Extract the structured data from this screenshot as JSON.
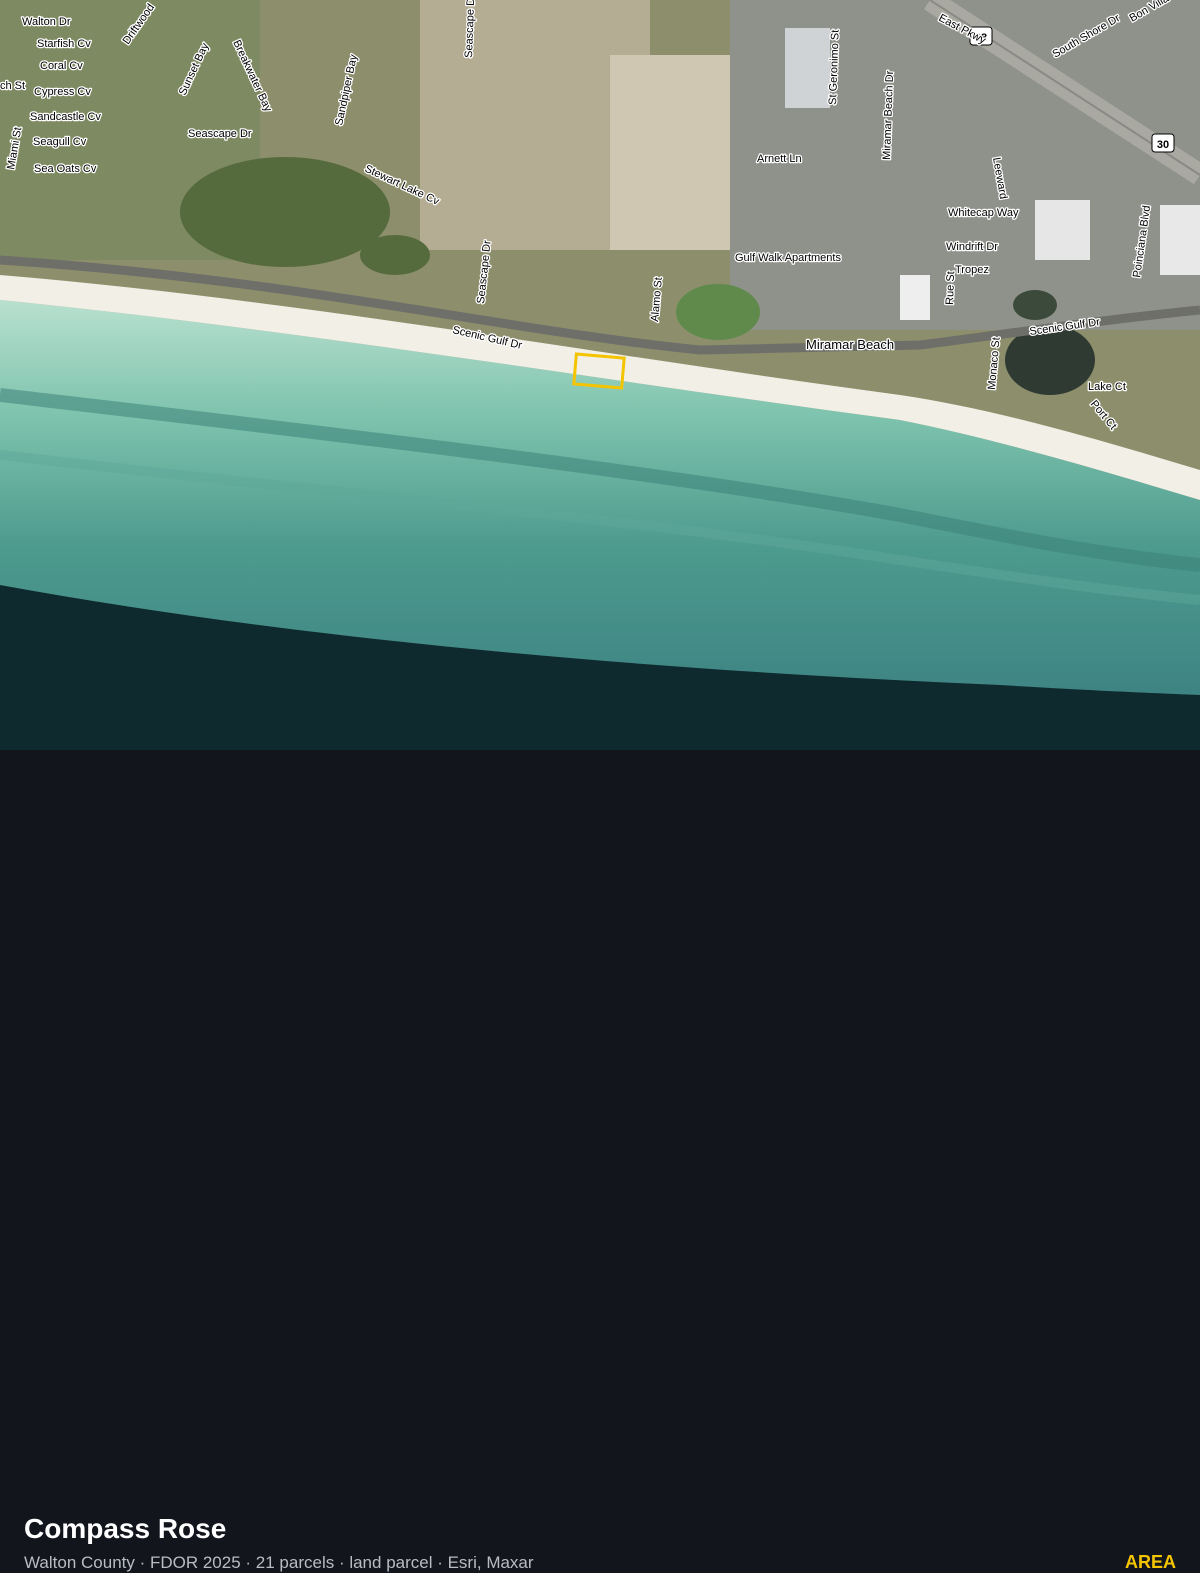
{
  "map": {
    "labels": {
      "walton_dr": "Walton Dr",
      "starfish_cv": "Starfish Cv",
      "coral_cv": "Coral Cv",
      "cypress_cv": "Cypress Cv",
      "sandcastle_cv": "Sandcastle Cv",
      "seagull_cv": "Seagull Cv",
      "sea_oats_cv": "Sea Oats Cv",
      "miami_st": "Miami St",
      "ch_st": "ch St",
      "driftwood": "Driftwood",
      "sunset_bay": "Sunset Bay",
      "breakwater_bay": "Breakwater Bay",
      "sandpiper_bay": "Sandpiper Bay",
      "seascape_dr_north": "Seascape Dr",
      "seascape_dr_west": "Seascape Dr",
      "stewart_lake_cv": "Stewart Lake Cv",
      "seascape_dr_south": "Seascape Dr",
      "scenic_gulf_dr_west": "Scenic Gulf Dr",
      "alamo_st": "Alamo St",
      "gulf_walk_apartments": "Gulf Walk Apartments",
      "arnett_ln": "Arnett Ln",
      "st_geronimo_st": "St Geronimo St",
      "miramar_beach_dr": "Miramar Beach Dr",
      "east_pkwy": "East Pkwy",
      "route_98": "98",
      "route_30": "30",
      "south_shore_dr": "South Shore Dr",
      "bon_villa_cir": "Bon Villa Cir",
      "whitecap_way": "Whitecap Way",
      "leeward": "Leeward",
      "windrift_dr": "Windrift Dr",
      "tropez": "Tropez",
      "rue_st": "Rue St",
      "poinciana_blvd": "Poinciana Blvd",
      "miramar_beach": "Miramar Beach",
      "scenic_gulf_dr_east": "Scenic Gulf Dr",
      "monaco_st": "Monaco St",
      "lake_ct": "Lake Ct",
      "port_ct": "Port Ct"
    },
    "parcel_color": "#f5c400"
  },
  "footer": {
    "title": "Compass Rose",
    "subtitle": "Walton County · FDOR 2025 · 21 parcels · land parcel · Esri, Maxar",
    "badge": "AREA"
  }
}
